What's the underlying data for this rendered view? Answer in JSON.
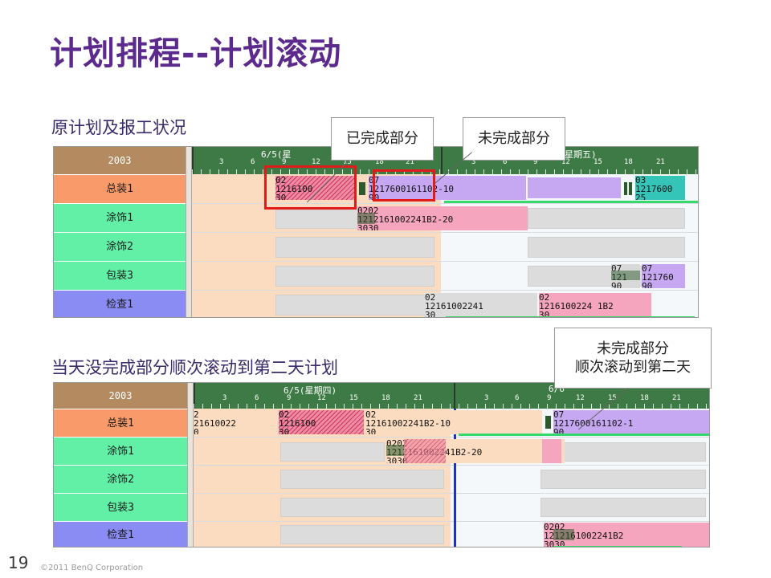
{
  "title": "计划排程--计划滚动",
  "section1_label": "原计划及报工状况",
  "section2_label": "当天没完成部分顺次滚动到第二天计划",
  "callouts": {
    "done": "已完成部分",
    "undone": "未完成部分",
    "rolled_line1": "未完成部分",
    "rolled_line2": "顺次滚动到第二天"
  },
  "gantt1": {
    "year": "2003",
    "day1": "6/5(星",
    "day2": "星期五)",
    "hours_day1": [
      "3",
      "6",
      "9",
      "12",
      "15",
      "18",
      "21"
    ],
    "hours_day2": [
      "3",
      "6",
      "9",
      "12",
      "15",
      "18",
      "21"
    ],
    "rows": [
      "总装1",
      "涂饰1",
      "涂饰2",
      "包装3",
      "检查1"
    ],
    "row_colors": [
      "#f99a6a",
      "#62f0a6",
      "#62f0a6",
      "#62f0a6",
      "#8a8cf4"
    ],
    "tasks": {
      "t1_top": "02",
      "t1_mid": "1216100",
      "t1_bot": "30",
      "t2_top": "07",
      "t2_mid": "1217600161102-10",
      "t2_bot": "90",
      "t3_top": "03",
      "t3_mid": "1217600",
      "t3_bot": "25",
      "t4_top": "0202",
      "t4_mid": "1212161002241B2-20",
      "t4_bot": "3030",
      "t5a_top": "07",
      "t5a_mid": "121",
      "t5a_bot": "90",
      "t5b_top": "07",
      "t5b_mid": "121760",
      "t5b_bot": "90",
      "t6a_top": "02",
      "t6a_mid": "12161002241",
      "t6a_bot": "30",
      "t6b_top": "02",
      "t6b_mid": "1216100224 1B2",
      "t6b_bot": "30"
    }
  },
  "gantt2": {
    "year": "2003",
    "day1": "6/5(星期四)",
    "day2": "6/6",
    "hours_day1": [
      "3",
      "6",
      "9",
      "12",
      "15",
      "18",
      "21"
    ],
    "hours_day2": [
      "3",
      "6",
      "9",
      "12",
      "15",
      "18",
      "21"
    ],
    "rows": [
      "总装1",
      "涂饰1",
      "涂饰2",
      "包装3",
      "检查1"
    ],
    "row_colors": [
      "#f99a6a",
      "#62f0a6",
      "#62f0a6",
      "#62f0a6",
      "#8a8cf4"
    ],
    "tasks": {
      "a_top": "2",
      "a_mid": "21610022",
      "a_bot": "0",
      "b_top": "02",
      "b_mid": "1216100",
      "b_bot": "30",
      "c_top": "02",
      "c_mid": "12161002241B2-10",
      "c_bot": "30",
      "d_top": "07",
      "d_mid": "1217600161102-1",
      "d_bot": "90",
      "e_top": "0202",
      "e_mid": "1212161002241B2-20",
      "e_bot": "3030",
      "f_top": "0202",
      "f_mid": "1212161002241B2",
      "f_bot": "3030"
    }
  },
  "footer": {
    "page_number": "19",
    "copyright": "©2011 BenQ Corporation"
  }
}
